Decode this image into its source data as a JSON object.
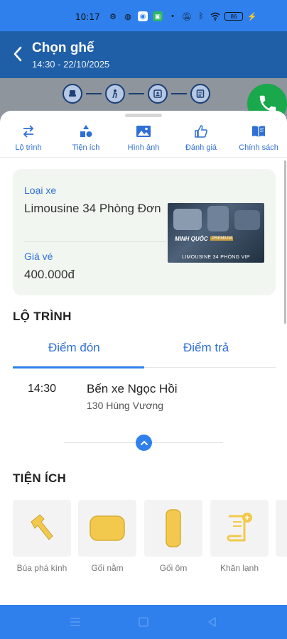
{
  "status_bar": {
    "time": "10:17",
    "battery": "86"
  },
  "header": {
    "title": "Chọn ghế",
    "subtitle": "14:30 - 22/10/2025",
    "background_color": "#1f5fa8"
  },
  "steps": [
    "seat-icon",
    "person-icon",
    "id-card-icon",
    "receipt-icon"
  ],
  "tabs": [
    {
      "label": "Lộ trình",
      "icon": "swap-arrows-icon"
    },
    {
      "label": "Tiện ích",
      "icon": "shapes-icon"
    },
    {
      "label": "Hình ảnh",
      "icon": "image-icon"
    },
    {
      "label": "Đánh giá",
      "icon": "thumbs-up-icon"
    },
    {
      "label": "Chính sách",
      "icon": "book-icon"
    }
  ],
  "vehicle_card": {
    "type_label": "Loại xe",
    "type_value": "Limousine 34 Phòng Đơn",
    "price_label": "Giá vé",
    "price_value": "400.000đ",
    "image": {
      "brand": "MINH QUỐC",
      "badge": "PREMIUM",
      "caption": "LIMOUSINE 34 PHÒNG VIP"
    }
  },
  "route": {
    "title": "LỘ TRÌNH",
    "tabs": [
      "Điểm đón",
      "Điểm trả"
    ],
    "active_tab": "Điểm đón",
    "stop": {
      "time": "14:30",
      "name": "Bến xe Ngọc Hồi",
      "address": "130 Hùng Vương"
    }
  },
  "amenities": {
    "title": "TIỆN ÍCH",
    "items": [
      {
        "label": "Búa phá kính",
        "icon": "hammer-icon"
      },
      {
        "label": "Gối nằm",
        "icon": "pillow-icon"
      },
      {
        "label": "Gối ôm",
        "icon": "bolster-pillow-icon"
      },
      {
        "label": "Khăn lạnh",
        "icon": "towel-icon"
      }
    ]
  },
  "colors": {
    "primary": "#2f80ed",
    "accent_text": "#2f6fd6",
    "call_button": "#1aa84c",
    "card_background": "#f1f7f0",
    "amenity_icon": "#f2c94c"
  }
}
